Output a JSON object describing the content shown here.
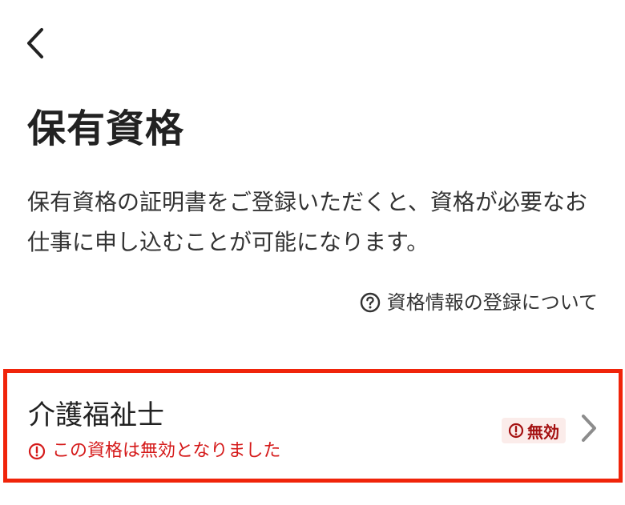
{
  "header": {
    "back_icon": "chevron-left-icon"
  },
  "page": {
    "title": "保有資格",
    "description": "保有資格の証明書をご登録いただくと、資格が必要なお仕事に申し込むことが可能になります。",
    "help_icon": "question-circle-icon",
    "help_link": "資格情報の登録について"
  },
  "licenses": [
    {
      "name": "介護福祉士",
      "note": "この資格は無効となりました",
      "note_icon": "exclamation-circle-icon",
      "status": "無効",
      "status_icon": "exclamation-circle-icon",
      "chevron_icon": "chevron-right-icon"
    }
  ],
  "colors": {
    "highlight_border": "#f0240a",
    "error_text": "#d51a1a",
    "badge_background": "#fbecea",
    "badge_text": "#a41010",
    "chevron": "#8c8c8c"
  }
}
